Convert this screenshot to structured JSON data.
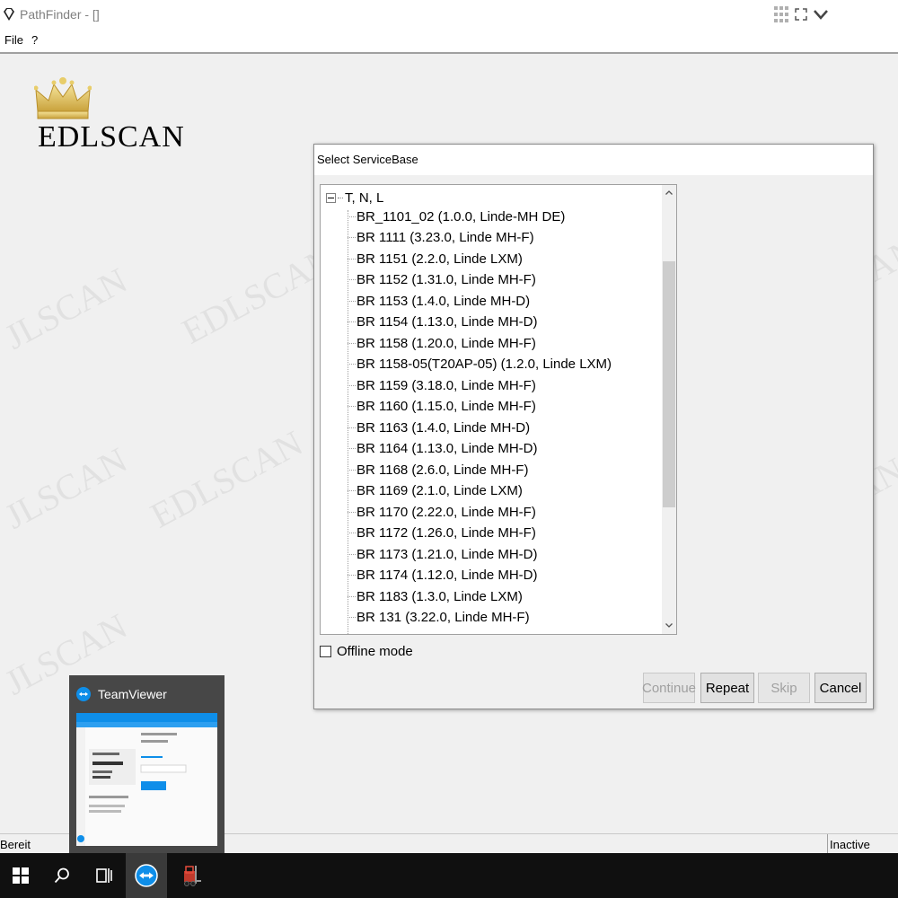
{
  "window": {
    "title": "PathFinder - []"
  },
  "menu": {
    "items": [
      "File",
      "?"
    ]
  },
  "logo": {
    "text": "EDLSCAN"
  },
  "watermark": {
    "text": "EDLSCAN",
    "partial": "JLSCAN"
  },
  "dialog": {
    "title": "Select ServiceBase",
    "tree": {
      "root": "T, N, L",
      "items": [
        "BR_1101_02 (1.0.0, Linde-MH DE)",
        "BR 1111 (3.23.0, Linde MH-F)",
        "BR 1151 (2.2.0, Linde LXM)",
        "BR 1152 (1.31.0, Linde MH-F)",
        "BR 1153 (1.4.0, Linde MH-D)",
        "BR 1154 (1.13.0, Linde MH-D)",
        "BR 1158 (1.20.0, Linde MH-F)",
        "BR 1158-05(T20AP-05) (1.2.0, Linde LXM)",
        "BR 1159 (3.18.0, Linde MH-F)",
        "BR 1160 (1.15.0, Linde MH-F)",
        "BR 1163 (1.4.0, Linde MH-D)",
        "BR 1164 (1.13.0, Linde MH-D)",
        "BR 1168 (2.6.0, Linde MH-F)",
        "BR 1169 (2.1.0, Linde LXM)",
        "BR 1170 (2.22.0, Linde MH-F)",
        "BR 1172 (1.26.0, Linde MH-F)",
        "BR 1173 (1.21.0, Linde MH-D)",
        "BR 1174 (1.12.0, Linde MH-D)",
        "BR 1183 (1.3.0, Linde LXM)",
        "BR 131 (3.22.0, Linde MH-F)"
      ]
    },
    "offline_label": "Offline mode",
    "offline_checked": false,
    "buttons": {
      "continue": "Continue",
      "repeat": "Repeat",
      "skip": "Skip",
      "cancel": "Cancel"
    }
  },
  "status": {
    "left": "Bereit",
    "right": "Inactive"
  },
  "teamviewer": {
    "title": "TeamViewer"
  },
  "colors": {
    "teamviewer_blue": "#0e8ee9",
    "dialog_bg": "#f0f0f0",
    "taskbar_bg": "#101010"
  }
}
